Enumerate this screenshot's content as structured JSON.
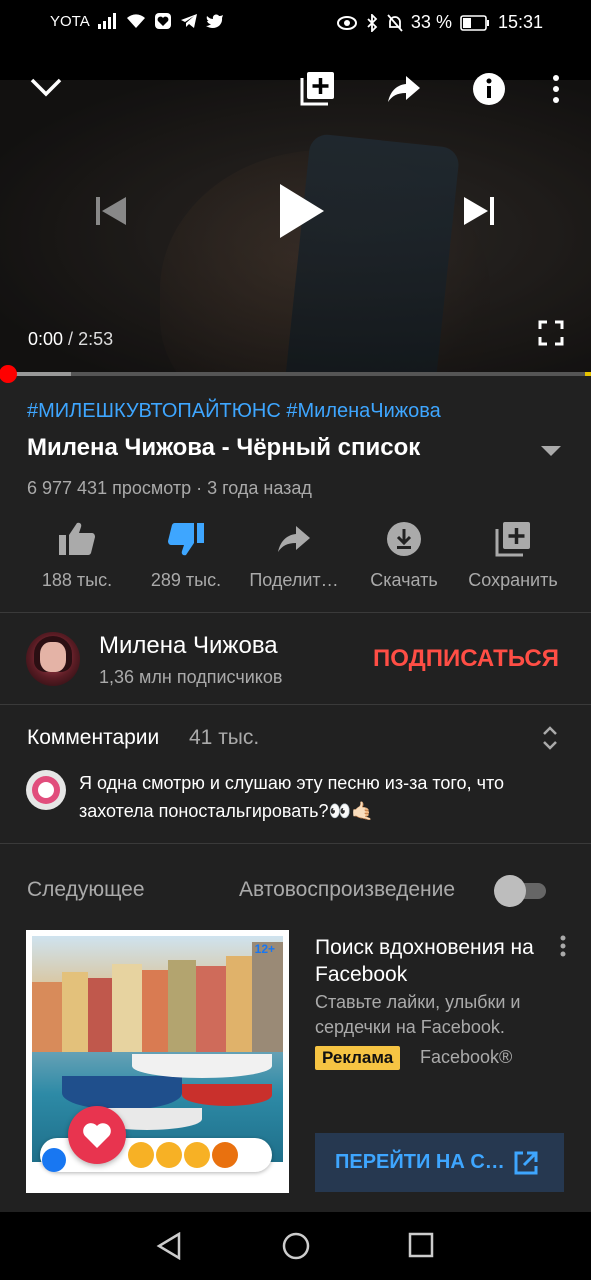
{
  "status_bar": {
    "carrier": "YOTA",
    "battery_percent": "33 %",
    "time": "15:31"
  },
  "player": {
    "current_time": "0:00",
    "separator": " / ",
    "duration": "2:53",
    "progress_fraction": 0.0,
    "buffered_fraction": 0.12
  },
  "video": {
    "hashtags": "#МИЛЕШКУВТОПАЙТЮНС #МиленаЧижова",
    "title": "Милена Чижова - Чёрный список",
    "meta": "6 977 431 просмотр · 3 года назад"
  },
  "actions": [
    {
      "id": "like",
      "label": "188 тыс.",
      "icon": "thumb-up-icon"
    },
    {
      "id": "dislike",
      "label": "289 тыс.",
      "icon": "thumb-down-icon"
    },
    {
      "id": "share",
      "label": "Поделит…",
      "icon": "share-icon"
    },
    {
      "id": "download",
      "label": "Скачать",
      "icon": "download-icon"
    },
    {
      "id": "save",
      "label": "Сохранить",
      "icon": "save-playlist-icon"
    }
  ],
  "channel": {
    "name": "Милена Чижова",
    "subscribers": "1,36 млн подписчиков",
    "subscribe_label": "ПОДПИСАТЬСЯ"
  },
  "comments": {
    "title": "Комментарии",
    "count": "41 тыс.",
    "top_comment": "Я одна смотрю и слушаю эту песню из-за того, что захотела поностальгировать?👀🤙🏻"
  },
  "up_next": {
    "label": "Следующее",
    "autoplay_label": "Автовоспроизведение",
    "autoplay_on": false
  },
  "ad": {
    "badge": "12+",
    "title": "Поиск вдохновения на Facebook",
    "description": "Ставьте лайки, улыбки и сердечки на Facebook.",
    "tag": "Реклама",
    "brand": "Facebook®",
    "cta": "ПЕРЕЙТИ НА С…"
  },
  "colors": {
    "accent_blue": "#3ea6ff",
    "subscribe_red": "#ff4e45",
    "progress_red": "#ff0000",
    "ad_tag_yellow": "#f6c443"
  }
}
